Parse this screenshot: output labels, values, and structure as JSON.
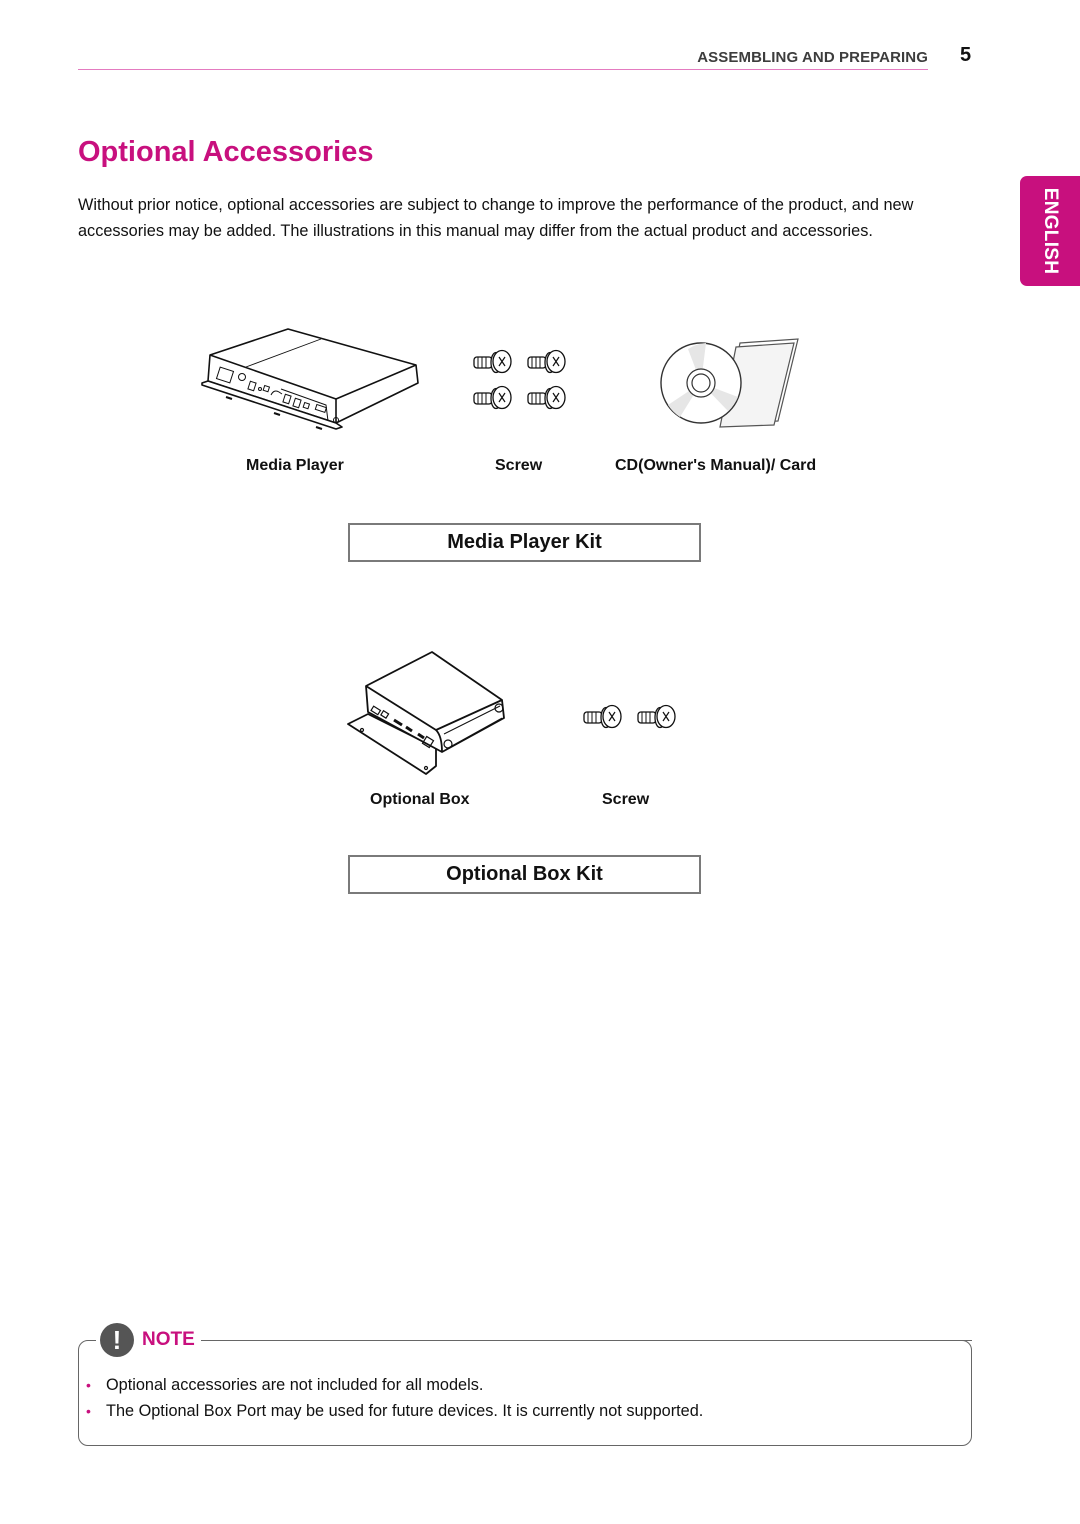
{
  "header": {
    "section_title": "ASSEMBLING AND PREPARING",
    "page_number": "5",
    "rule_color": "#e47bc0"
  },
  "page_title": "Optional Accessories",
  "intro": "Without prior notice, optional accessories are subject to change to improve the performance of the product, and new accessories may be added. The illustrations in this manual may differ from the actual product and accessories.",
  "language_tab": "ENGLISH",
  "accent_color": "#c8107e",
  "kits": [
    {
      "name": "Media Player Kit",
      "items": [
        {
          "label": "Media Player",
          "icon": "media-player-illustration"
        },
        {
          "label": "Screw",
          "icon": "screw-set-4-illustration"
        },
        {
          "label": "CD(Owner's Manual)/ Card",
          "icon": "cd-and-card-illustration"
        }
      ]
    },
    {
      "name": "Optional Box Kit",
      "items": [
        {
          "label": "Optional Box",
          "icon": "optional-box-illustration"
        },
        {
          "label": "Screw",
          "icon": "screw-set-2-illustration"
        }
      ]
    }
  ],
  "note": {
    "label": "NOTE",
    "icon": "exclamation-icon",
    "items": [
      "Optional accessories are not included for all models.",
      "The Optional Box Port may be used for future devices. It is currently not supported."
    ]
  }
}
